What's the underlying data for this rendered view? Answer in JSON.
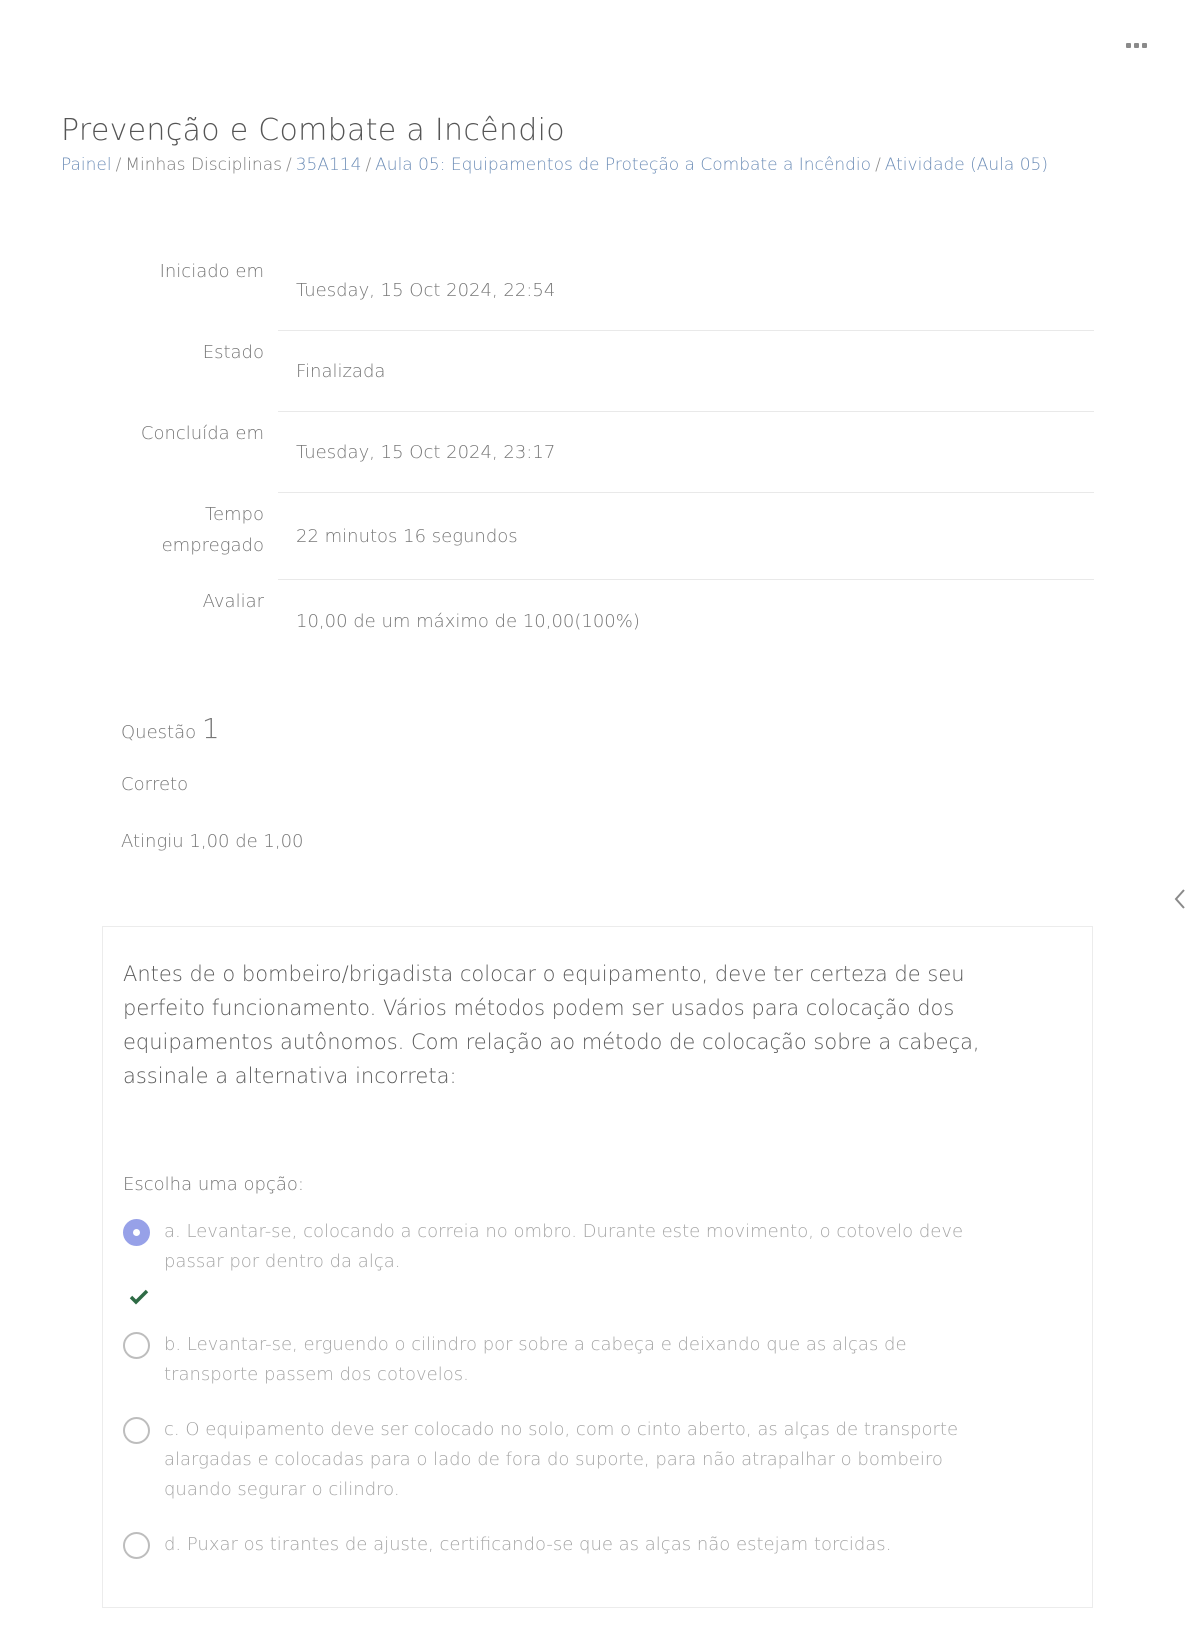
{
  "header": {
    "menu_icon": "more-dots-icon",
    "title": "Prevenção e Combate a Incêndio"
  },
  "breadcrumb": {
    "items": [
      "Painel",
      "Minhas Disciplinas",
      "35A114",
      "Aula 05: Equipamentos de Proteção a Combate a Incêndio",
      "Atividade (Aula 05)"
    ],
    "separator": "/"
  },
  "summary": {
    "rows": [
      {
        "label": "Iniciado em",
        "value": "Tuesday, 15 Oct 2024, 22:54"
      },
      {
        "label": "Estado",
        "value": "Finalizada"
      },
      {
        "label": "Concluída em",
        "value": "Tuesday, 15 Oct 2024, 23:17"
      },
      {
        "label": "Tempo empregado",
        "value": "22 minutos 16 segundos"
      },
      {
        "label": "Avaliar",
        "value": "10,00 de um máximo de 10,00(100%)"
      }
    ]
  },
  "question": {
    "label": "Questão",
    "number": "1",
    "status": "Correto",
    "score": "Atingiu 1,00 de 1,00",
    "text": "Antes de o bombeiro/brigadista colocar o equipamento, deve ter certeza de seu perfeito funcionamento. Vários métodos podem ser usados para colocação dos equipamentos autônomos. Com relação ao método de colocação sobre a cabeça, assinale a alternativa incorreta:",
    "prompt": "Escolha uma opção:",
    "options": [
      {
        "text": "a. Levantar-se, colocando a correia no ombro. Durante este movimento, o cotovelo deve passar por dentro da alça.",
        "selected": true
      },
      {
        "text": "b. Levantar-se, erguendo o cilindro por sobre a cabeça e deixando que as alças de transporte passem dos cotovelos.",
        "selected": false
      },
      {
        "text": "c. O equipamento deve ser colocado no solo, com o cinto aberto, as alças de transporte alargadas e colocadas para o lado de fora do suporte, para não atrapalhar o bombeiro quando segurar o cilindro.",
        "selected": false
      },
      {
        "text": "d. Puxar os tirantes de ajuste, certificando-se que as alças não estejam torcidas.",
        "selected": false
      }
    ],
    "correct_icon": "check-icon"
  },
  "colors": {
    "link": "#6f8fb8",
    "radio_selected": "#97a1e8",
    "check": "#2e6b45"
  }
}
